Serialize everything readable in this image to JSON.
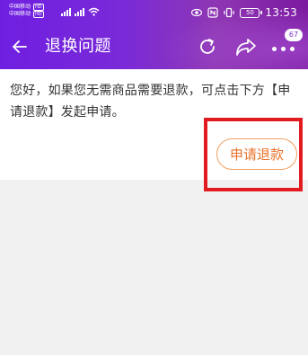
{
  "status_bar": {
    "carrier_line1": "中国移动",
    "carrier_line2": "中国移动",
    "carrier_tag1": "HD",
    "carrier_tag2": "HD",
    "network_label": "4G",
    "battery": "50",
    "time": "13:53"
  },
  "nav": {
    "title": "退换问题",
    "notification_count": "67"
  },
  "message": {
    "text": "您好，如果您无需商品需要退款，可点击下方【申请退款】发起申请。"
  },
  "button": {
    "refund_label": "申请退款"
  },
  "colors": {
    "header_start": "#6f1fe0",
    "header_end": "#7b1a9f",
    "button_text": "#e8722a",
    "button_border": "#f0a060",
    "highlight_frame": "#e21b20"
  }
}
